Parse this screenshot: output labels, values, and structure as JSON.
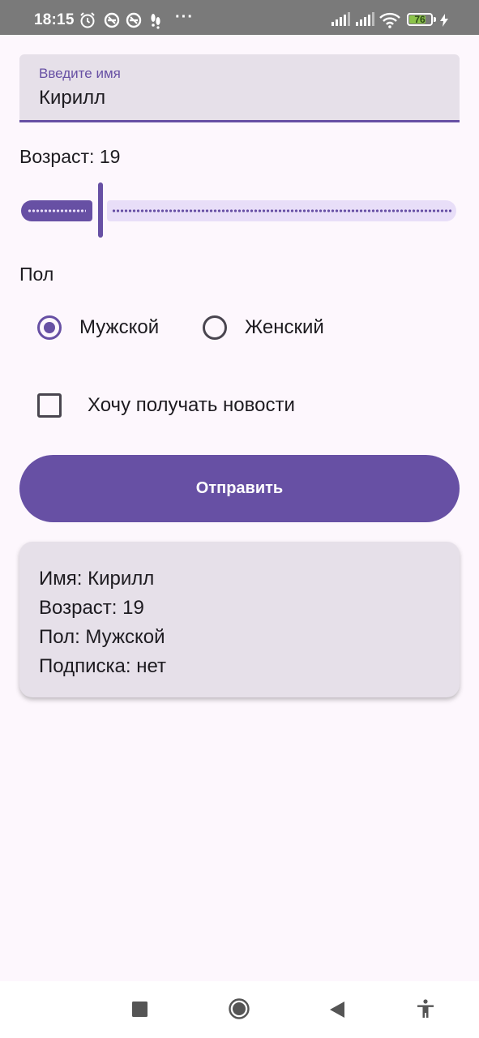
{
  "status_bar": {
    "time": "18:15",
    "dots": "···",
    "battery": "76",
    "battery_level": 0.76,
    "icons": [
      "alarm-icon",
      "dnd-icon",
      "dnd-icon",
      "footprints-icon",
      "signal-icon",
      "signal-icon",
      "wifi-icon",
      "battery-icon",
      "charging-icon"
    ]
  },
  "form": {
    "name_label": "Введите имя",
    "name_value": "Кирилл",
    "age_label": "Возраст: 19",
    "age_slider_fraction": 0.19,
    "gender_label": "Пол",
    "gender_options": [
      "Мужской",
      "Женский"
    ],
    "gender_selected": "Мужской",
    "newsletter_label": "Хочу получать новости",
    "newsletter_checked": false,
    "submit_label": "Отправить"
  },
  "result": {
    "name": "Имя: Кирилл",
    "age": "Возраст: 19",
    "gender": "Пол: Мужской",
    "subscription": "Подписка: нет"
  },
  "colors": {
    "primary": "#6750A4",
    "surface": "#FDF7FD",
    "surface_variant": "#E6E0E9",
    "status_bar": "#7A7A7A"
  },
  "nav_bar": {
    "buttons": [
      "recents-icon",
      "home-icon",
      "back-icon",
      "accessibility-icon"
    ]
  }
}
